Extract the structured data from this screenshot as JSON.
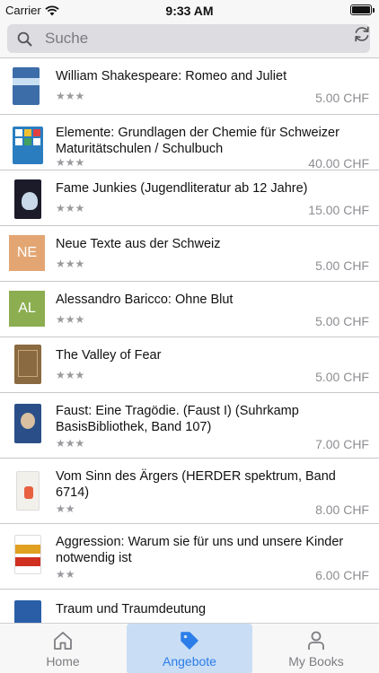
{
  "status_bar": {
    "carrier": "Carrier",
    "time": "9:33 AM"
  },
  "search": {
    "placeholder": "Suche"
  },
  "books": [
    {
      "title": "William Shakespeare: Romeo and Juliet",
      "rating": 3,
      "price": "5.00 CHF",
      "thumb": "cover",
      "cover_color": "#3d6da8"
    },
    {
      "title": "Elemente: Grundlagen der Chemie für Schweizer Maturitätschulen / Schulbuch",
      "rating": 3,
      "price": "40.00 CHF",
      "thumb": "cover",
      "cover_color": "#2a7ec0"
    },
    {
      "title": "Fame Junkies (Jugendliteratur ab 12 Jahre)",
      "rating": 3,
      "price": "15.00 CHF",
      "thumb": "cover",
      "cover_color": "#1b1b2a"
    },
    {
      "title": "Neue Texte aus der Schweiz",
      "rating": 3,
      "price": "5.00 CHF",
      "thumb": "initials",
      "initials": "NE",
      "cover_color": "#e3a673"
    },
    {
      "title": "Alessandro Baricco: Ohne Blut",
      "rating": 3,
      "price": "5.00 CHF",
      "thumb": "initials",
      "initials": "AL",
      "cover_color": "#8cae50"
    },
    {
      "title": "The Valley of Fear",
      "rating": 3,
      "price": "5.00 CHF",
      "thumb": "cover",
      "cover_color": "#8a6a40"
    },
    {
      "title": "Faust: Eine Tragödie. (Faust I) (Suhrkamp BasisBibliothek, Band 107)",
      "rating": 3,
      "price": "7.00 CHF",
      "thumb": "cover",
      "cover_color": "#2a4f88"
    },
    {
      "title": "Vom Sinn des Ärgers (HERDER spektrum, Band 6714)",
      "rating": 2,
      "price": "8.00 CHF",
      "thumb": "cover",
      "cover_color": "#f2f0ea"
    },
    {
      "title": "Aggression: Warum sie für uns und unsere Kinder notwendig ist",
      "rating": 2,
      "price": "6.00 CHF",
      "thumb": "cover",
      "cover_color": "#e0a020"
    },
    {
      "title": "Traum und Traumdeutung",
      "rating": 0,
      "price": "",
      "thumb": "cover",
      "cover_color": "#2a5fa8"
    }
  ],
  "tabs": [
    {
      "label": "Home",
      "icon": "home-icon",
      "active": false
    },
    {
      "label": "Angebote",
      "icon": "tag-icon",
      "active": true
    },
    {
      "label": "My Books",
      "icon": "person-icon",
      "active": false
    }
  ],
  "colors": {
    "accent": "#2b7de9",
    "active_tab_bg": "#c9ddf5",
    "star": "#9a9a9e"
  }
}
